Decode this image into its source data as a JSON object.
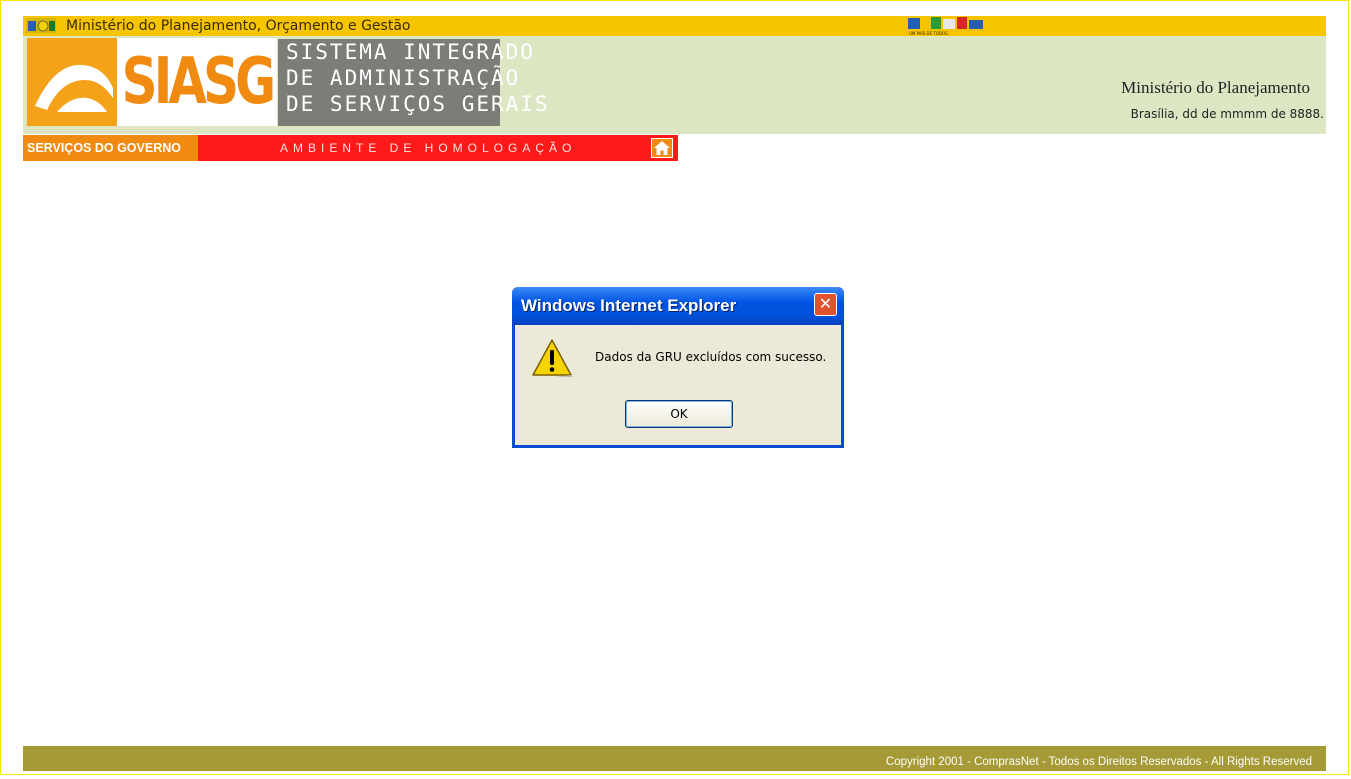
{
  "topbar": {
    "title": "Ministério do Planejamento, Orçamento e Gestão",
    "brasil_logo_text": "UM PAÍS DE TODOS"
  },
  "header": {
    "logo_mark": "SIASG",
    "logo_lines": [
      "SISTEMA INTEGRADO",
      "DE ADMINISTRAÇÃO",
      "DE SERVIÇOS GERAIS"
    ],
    "ministry": "Ministério do Planejamento",
    "dateline": "Brasília, dd de mmmm de 8888."
  },
  "navbar": {
    "servicos": "SERVIÇOS DO GOVERNO",
    "ambiente": "AMBIENTE DE HOMOLOGAÇÃO",
    "home_icon": "home-icon"
  },
  "dialog": {
    "title": "Windows Internet Explorer",
    "message": "Dados da GRU excluídos com sucesso.",
    "ok_label": "OK",
    "close_glyph": "✕",
    "warning_icon": "warning-icon"
  },
  "footer": {
    "copyright": "Copyright 2001 - ComprasNet - Todos os Direitos Reservados - All Rights Reserved"
  },
  "colors": {
    "topbar": "#f7c500",
    "header": "#dce6c2",
    "orange": "#f08a10",
    "red": "#ff1a1a",
    "footer": "#a59a35",
    "dialog_blue": "#0054e3"
  }
}
